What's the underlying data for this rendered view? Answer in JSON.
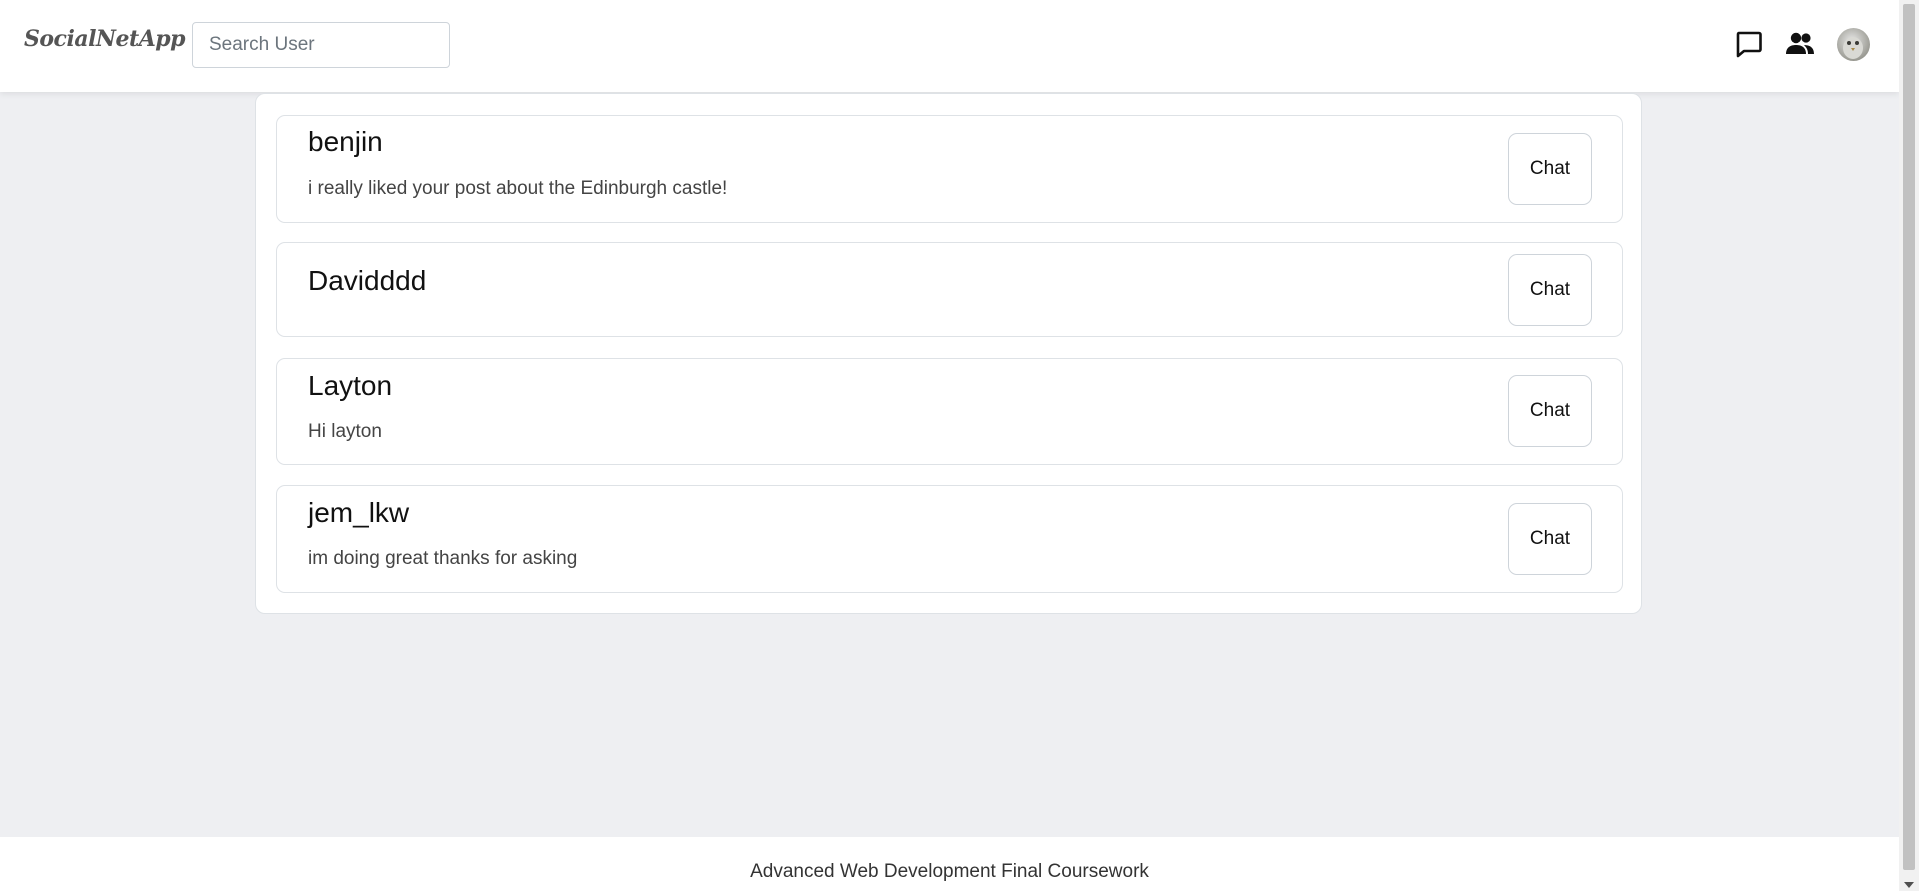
{
  "navbar": {
    "brand": "SocialNetApp",
    "search_placeholder": "Search User",
    "icons": [
      "chat-bubble-icon",
      "friends-icon",
      "user-avatar"
    ]
  },
  "conversations": [
    {
      "name": "benjin",
      "last_message": "i really liked your post about the Edinburgh castle!",
      "button": "Chat"
    },
    {
      "name": "Davidddd",
      "last_message": "",
      "button": "Chat"
    },
    {
      "name": "Layton",
      "last_message": "Hi layton",
      "button": "Chat"
    },
    {
      "name": "jem_lkw",
      "last_message": "im doing great thanks for asking",
      "button": "Chat"
    }
  ],
  "footer": {
    "text": "Advanced Web Development Final Coursework"
  },
  "colors": {
    "background": "#eeeff2",
    "card": "#ffffff",
    "border": "#dee2e6"
  }
}
